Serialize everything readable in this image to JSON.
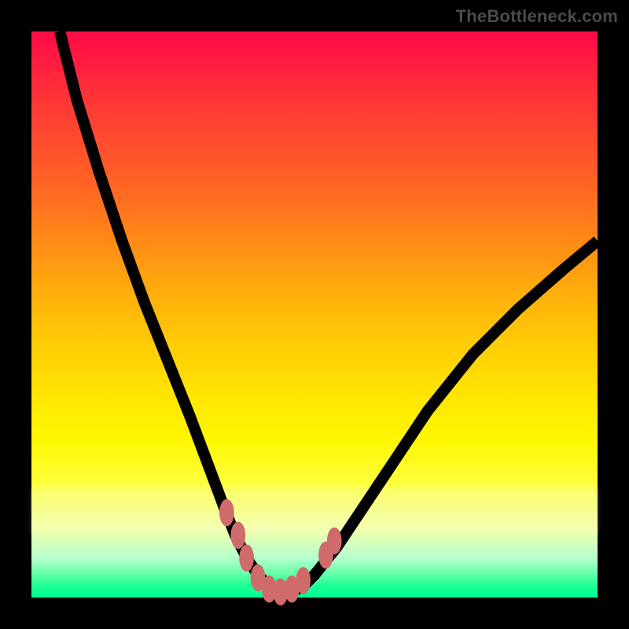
{
  "attribution": "TheBottleneck.com",
  "chart_data": {
    "type": "line",
    "title": "",
    "xlabel": "",
    "ylabel": "",
    "xlim": [
      0,
      100
    ],
    "ylim": [
      0,
      100
    ],
    "series": [
      {
        "name": "bottleneck-curve",
        "x": [
          5,
          8,
          12,
          16,
          20,
          24,
          28,
          31,
          34,
          36,
          38,
          40,
          42,
          44,
          46,
          48,
          50,
          54,
          58,
          64,
          70,
          78,
          86,
          94,
          100
        ],
        "y": [
          100,
          88,
          75,
          63,
          52,
          42,
          32,
          24,
          16,
          11,
          7,
          4,
          2,
          1,
          1,
          2,
          4,
          9,
          15,
          24,
          33,
          43,
          51,
          58,
          63
        ]
      }
    ],
    "highlight_points": {
      "name": "near-minimum-markers",
      "x": [
        34.5,
        36.5,
        38.0,
        40.0,
        42.0,
        44.0,
        46.0,
        48.0,
        52.0,
        53.5
      ],
      "y": [
        15.0,
        11.0,
        7.0,
        3.5,
        1.5,
        1.0,
        1.5,
        3.0,
        7.5,
        10.0
      ]
    },
    "background_gradient": {
      "top": "#ff0a46",
      "mid": "#ffe402",
      "bottom": "#00ff90"
    }
  }
}
